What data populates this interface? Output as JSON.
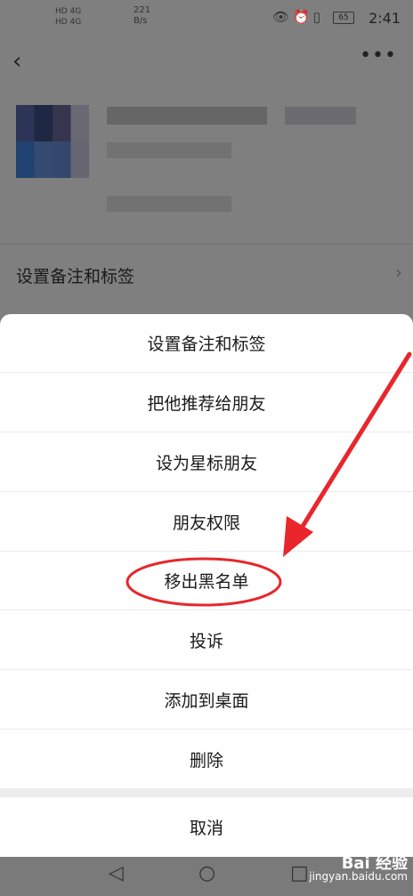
{
  "status_bar": {
    "time": "2:41",
    "battery": "65",
    "net_speed_value": "221",
    "net_speed_unit": "B/s",
    "signal_1": "HD 4G",
    "signal_2": "HD 4G",
    "icons": [
      "eye-icon",
      "alarm-icon",
      "vibrate-icon"
    ]
  },
  "background_page": {
    "back_glyph": "‹",
    "more_glyph": "•••",
    "row_label": "设置备注和标签",
    "row_chevron": "›"
  },
  "action_sheet": {
    "items": [
      {
        "label": "设置备注和标签"
      },
      {
        "label": "把他推荐给朋友"
      },
      {
        "label": "设为星标朋友"
      },
      {
        "label": "朋友权限"
      },
      {
        "label": "移出黑名单"
      },
      {
        "label": "投诉"
      },
      {
        "label": "添加到桌面"
      },
      {
        "label": "删除"
      }
    ],
    "cancel_label": "取消",
    "highlighted_item": "移出黑名单"
  },
  "annotation": {
    "color": "#e8262b",
    "type": "red-ellipse-and-arrow"
  },
  "nav_bar": {
    "back_glyph": "◁",
    "home_glyph": "○",
    "recent_glyph": "□"
  },
  "watermark": {
    "brand": "Bai 经验",
    "url": "jingyan.baidu.com"
  }
}
